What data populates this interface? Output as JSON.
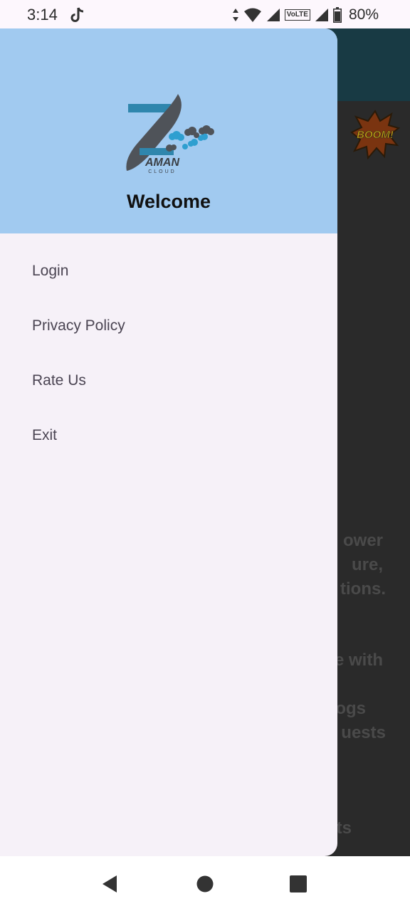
{
  "status_bar": {
    "time": "3:14",
    "battery": "80%",
    "network_label": "VoLTE",
    "icons": [
      "tiktok-icon",
      "data-arrows-icon",
      "wifi-icon",
      "signal-icon",
      "volte-icon",
      "signal-icon",
      "battery-icon"
    ]
  },
  "background_app": {
    "badge_text": "BOOM!",
    "lines": [
      "ower",
      "ure,",
      "tions.",
      "e with",
      "ogs",
      "uests",
      "ts"
    ],
    "colors": {
      "toolbar": "#183a44",
      "scrim": "#2a2a2a"
    }
  },
  "drawer": {
    "brand": "AMAN",
    "brand_sub": "CLOUD",
    "welcome": "Welcome",
    "menu": [
      {
        "label": "Login"
      },
      {
        "label": "Privacy Policy"
      },
      {
        "label": "Rate Us"
      },
      {
        "label": "Exit"
      }
    ],
    "colors": {
      "header": "#a1caf0",
      "body": "#f6f1f8"
    }
  },
  "nav_bar": {
    "buttons": [
      "back-icon",
      "home-icon",
      "recents-icon"
    ]
  }
}
